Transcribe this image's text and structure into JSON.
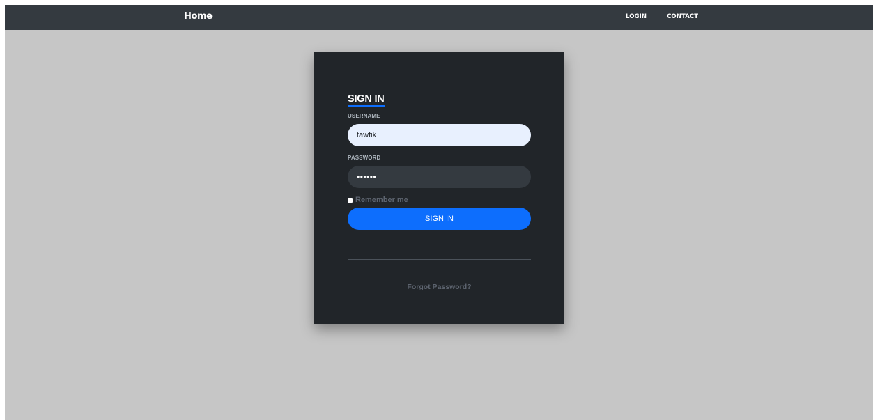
{
  "navbar": {
    "brand": "Home",
    "links": [
      {
        "label": "LOGIN"
      },
      {
        "label": "CONTACT"
      }
    ]
  },
  "login_card": {
    "title": "SIGN IN",
    "username": {
      "label": "USERNAME",
      "value": "tawfik"
    },
    "password": {
      "label": "PASSWORD",
      "value": "tawfik"
    },
    "remember_me": {
      "label": "Remember me",
      "checked": false
    },
    "submit_label": "SIGN IN",
    "forgot_password": "Forgot Password?"
  },
  "colors": {
    "navbar": "#343a40",
    "page_background": "#c6c6c6",
    "card_background": "#212529",
    "accent": "#0d6efd",
    "username_input_background": "#e8f0fe",
    "password_input_background": "#343a40",
    "muted_text": "#5d646f"
  }
}
